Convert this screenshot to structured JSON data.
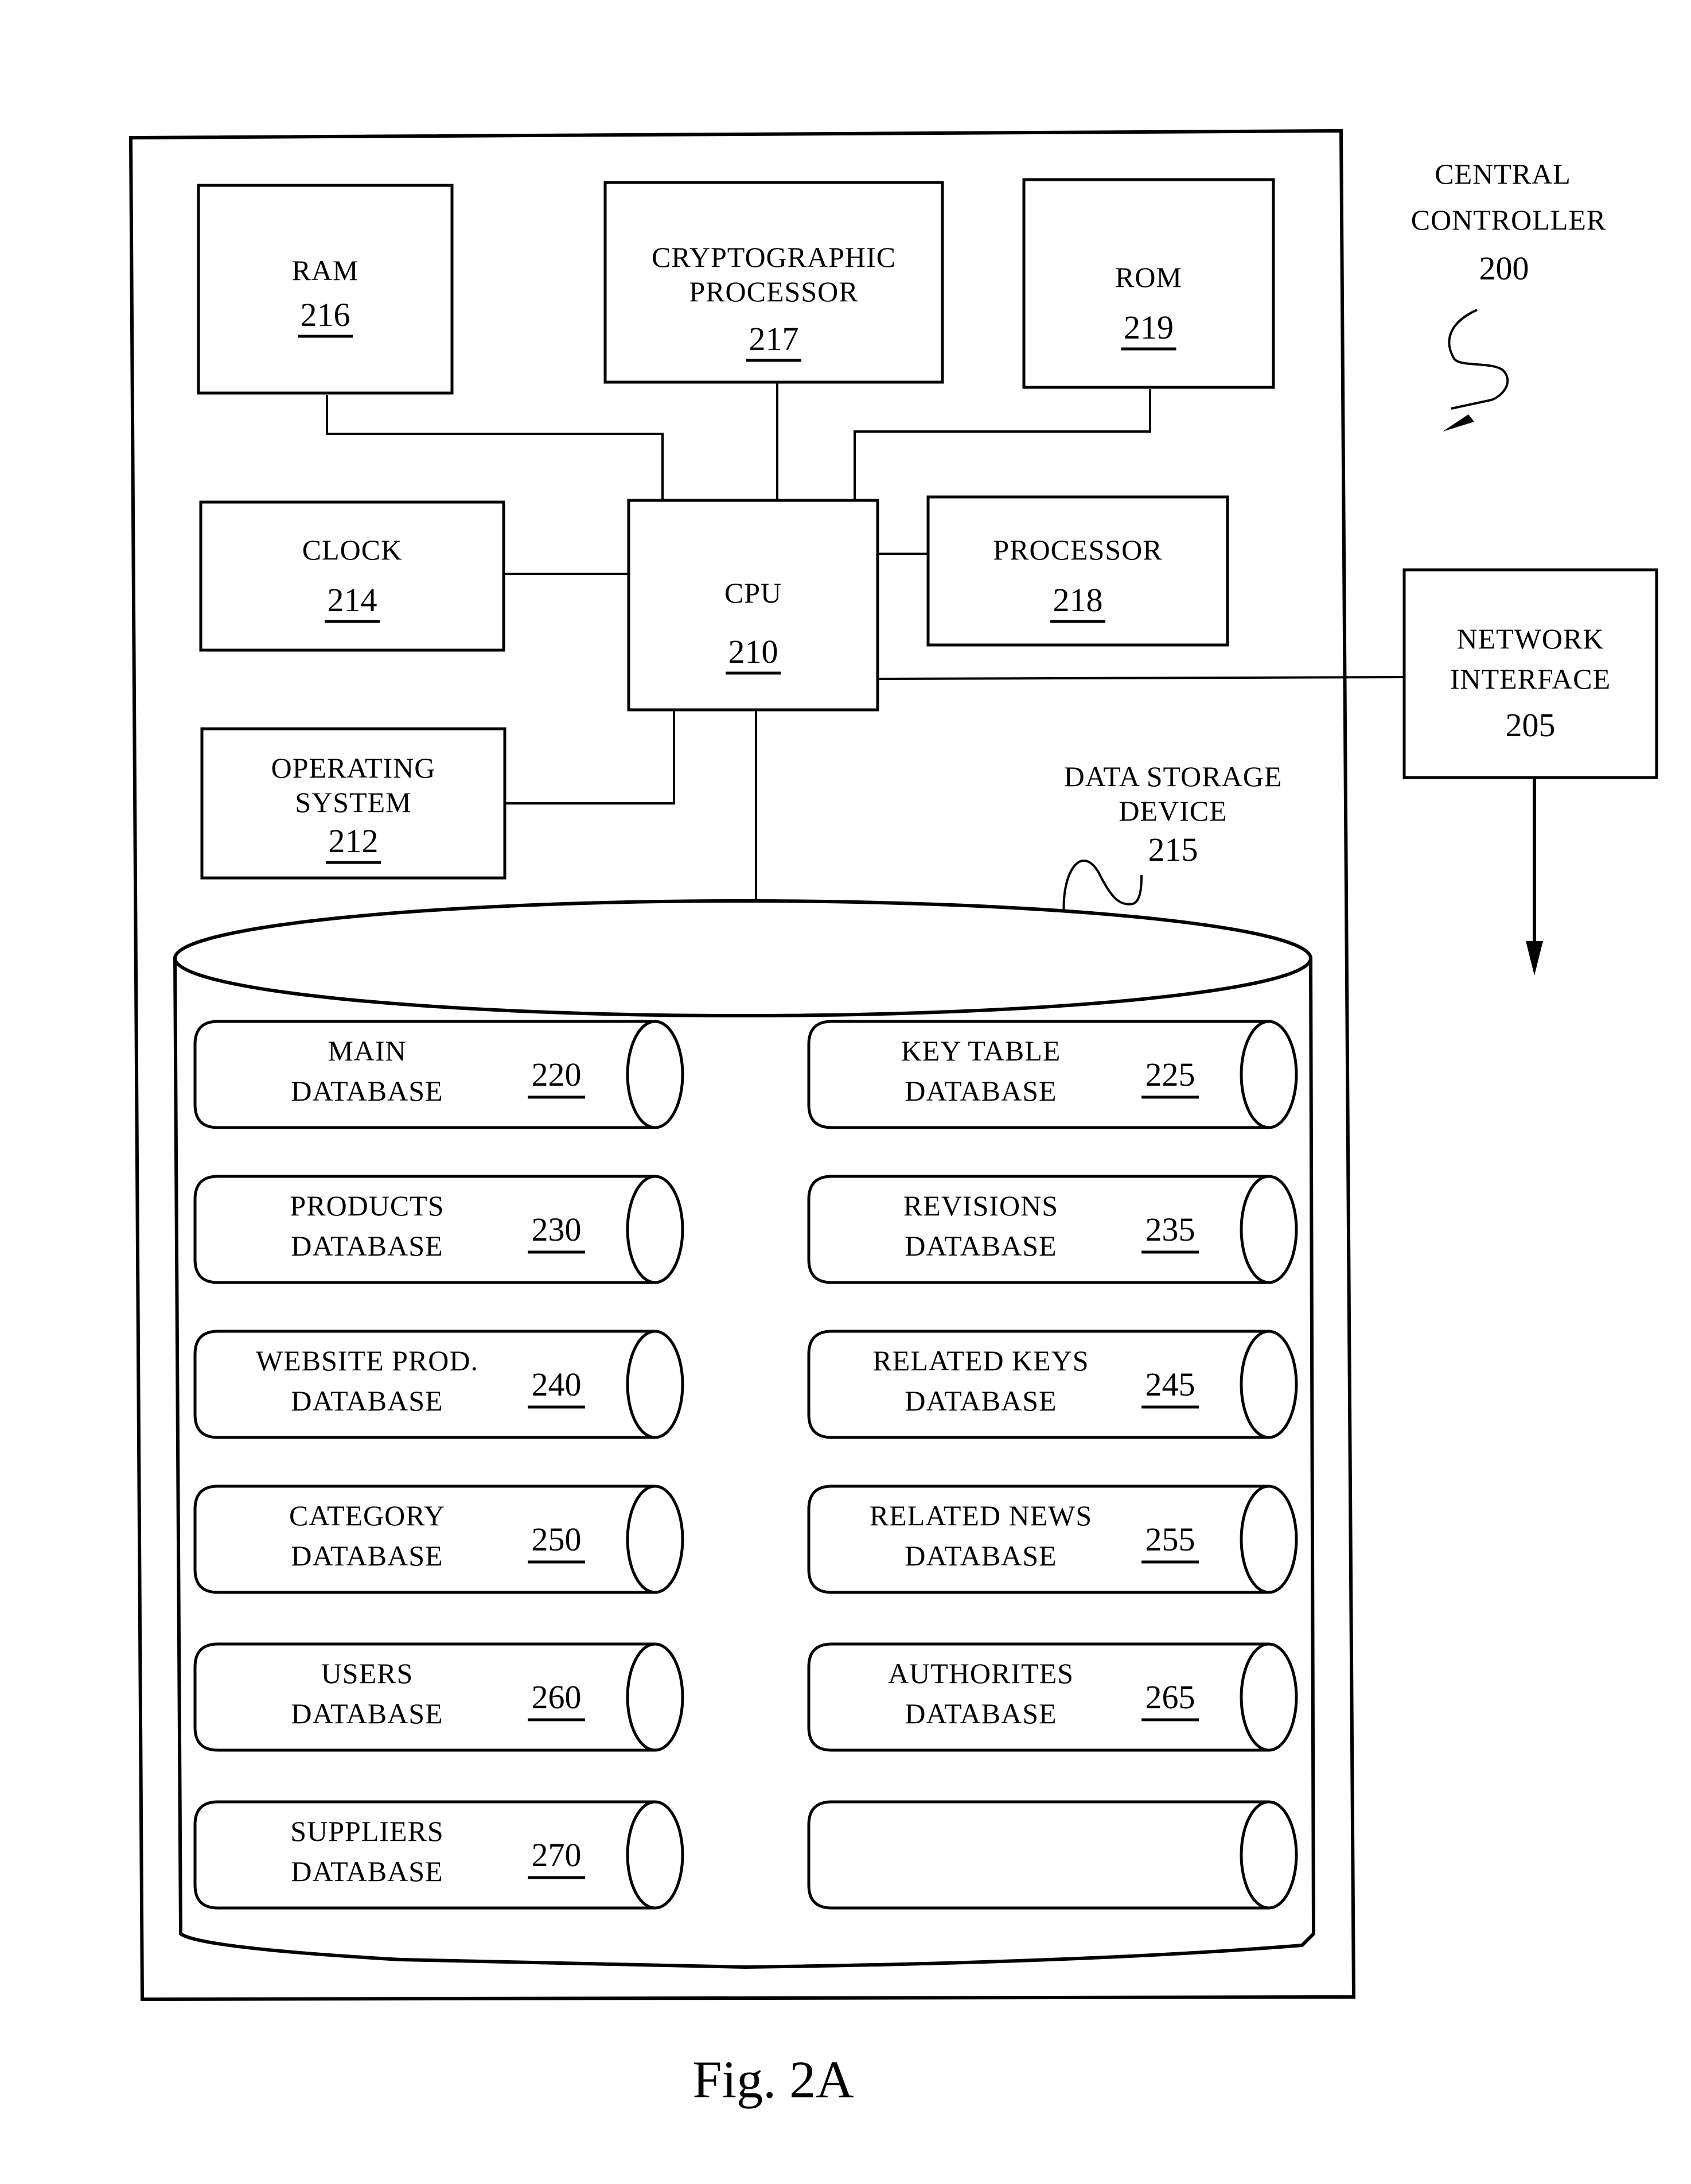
{
  "figure": {
    "caption": "Fig. 2A",
    "title": {
      "line1": "CENTRAL",
      "line2": "CONTROLLER",
      "ref": "200"
    }
  },
  "components": {
    "ram": {
      "lines": [
        "RAM"
      ],
      "ref": "216"
    },
    "crypto": {
      "lines": [
        "CRYPTOGRAPHIC",
        "PROCESSOR"
      ],
      "ref": "217"
    },
    "rom": {
      "lines": [
        "ROM"
      ],
      "ref": "219"
    },
    "clock": {
      "lines": [
        "CLOCK"
      ],
      "ref": "214"
    },
    "cpu": {
      "lines": [
        "CPU"
      ],
      "ref": "210"
    },
    "processor": {
      "lines": [
        "PROCESSOR"
      ],
      "ref": "218"
    },
    "os": {
      "lines": [
        "OPERATING",
        "SYSTEM"
      ],
      "ref": "212"
    },
    "network": {
      "lines": [
        "NETWORK",
        "INTERFACE"
      ],
      "ref": "205"
    },
    "storage": {
      "lines": [
        "DATA STORAGE",
        "DEVICE"
      ],
      "ref": "215"
    }
  },
  "databases": [
    {
      "lines": [
        "MAIN",
        "DATABASE"
      ],
      "ref": "220"
    },
    {
      "lines": [
        "KEY TABLE",
        "DATABASE"
      ],
      "ref": "225"
    },
    {
      "lines": [
        "PRODUCTS",
        "DATABASE"
      ],
      "ref": "230"
    },
    {
      "lines": [
        "REVISIONS",
        "DATABASE"
      ],
      "ref": "235"
    },
    {
      "lines": [
        "WEBSITE PROD.",
        "DATABASE"
      ],
      "ref": "240"
    },
    {
      "lines": [
        "RELATED KEYS",
        "DATABASE"
      ],
      "ref": "245"
    },
    {
      "lines": [
        "CATEGORY",
        "DATABASE"
      ],
      "ref": "250"
    },
    {
      "lines": [
        "RELATED NEWS",
        "DATABASE"
      ],
      "ref": "255"
    },
    {
      "lines": [
        "USERS",
        "DATABASE"
      ],
      "ref": "260"
    },
    {
      "lines": [
        "AUTHORITES",
        "DATABASE"
      ],
      "ref": "265"
    },
    {
      "lines": [
        "SUPPLIERS",
        "DATABASE"
      ],
      "ref": "270"
    },
    {
      "lines": [],
      "ref": ""
    }
  ]
}
